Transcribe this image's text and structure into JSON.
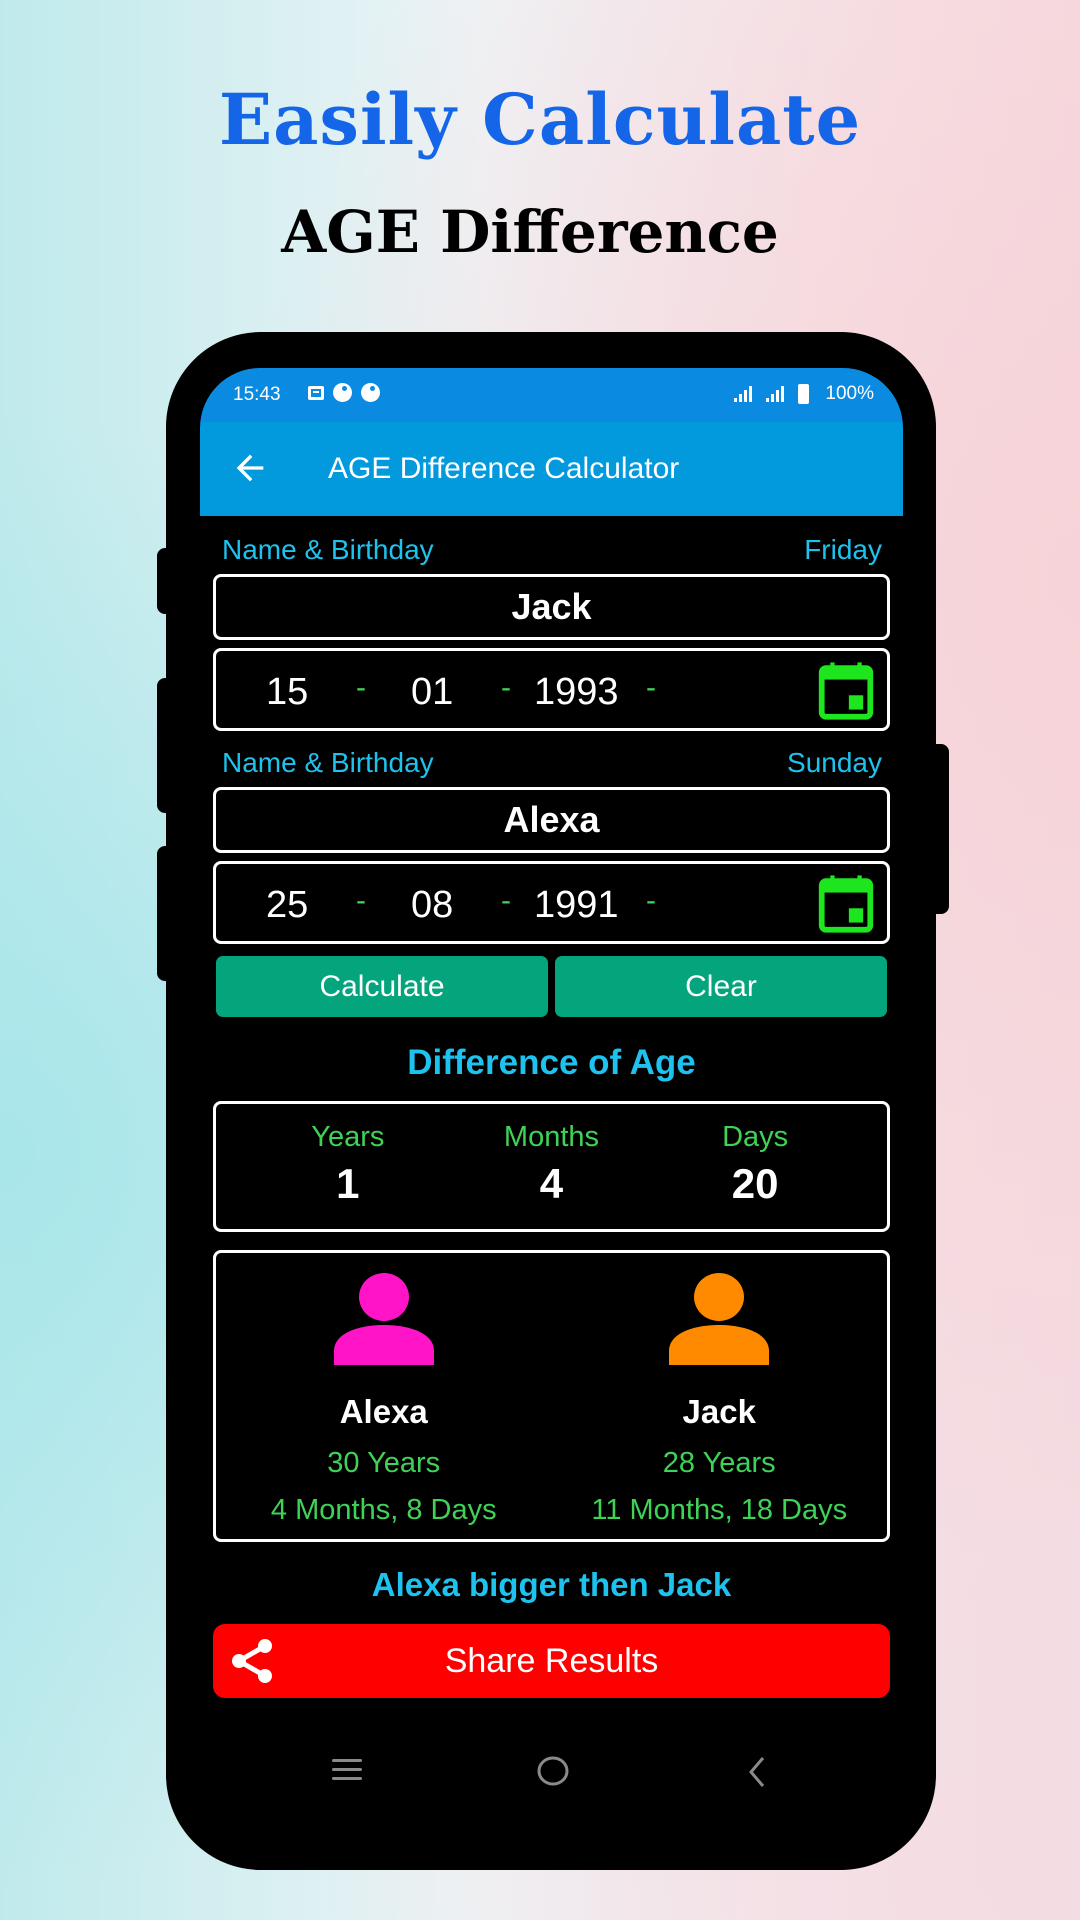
{
  "promo": {
    "title": "Easily Calculate",
    "subtitle": "AGE Difference"
  },
  "status_bar": {
    "time": "15:43",
    "battery": "100%"
  },
  "app_bar": {
    "title": "AGE Difference Calculator",
    "back_icon": "arrow-left-icon"
  },
  "person1": {
    "label": "Name & Birthday",
    "weekday": "Friday",
    "name": "Jack",
    "day": "15",
    "month": "01",
    "year": "1993",
    "separator": "-"
  },
  "person2": {
    "label": "Name & Birthday",
    "weekday": "Sunday",
    "name": "Alexa",
    "day": "25",
    "month": "08",
    "year": "1991",
    "separator": "-"
  },
  "buttons": {
    "calculate": "Calculate",
    "clear": "Clear"
  },
  "difference": {
    "title": "Difference of Age",
    "items": [
      {
        "label": "Years",
        "value": "1"
      },
      {
        "label": "Months",
        "value": "4"
      },
      {
        "label": "Days",
        "value": "20"
      }
    ]
  },
  "ages": [
    {
      "name": "Alexa",
      "years": "30 Years",
      "rest": "4 Months, 8 Days",
      "color": "#ff14c8"
    },
    {
      "name": "Jack",
      "years": "28 Years",
      "rest": "11 Months, 18 Days",
      "color": "#ff8a00"
    }
  ],
  "verdict": "Alexa bigger then Jack",
  "share": {
    "label": "Share Results",
    "icon": "share-icon"
  },
  "colors": {
    "accent": "#1ec2ee",
    "green": "#3ed256",
    "button": "#04a47c",
    "share": "#fe0000",
    "app_bar": "#0299dd",
    "calendar": "#1ee61e"
  }
}
